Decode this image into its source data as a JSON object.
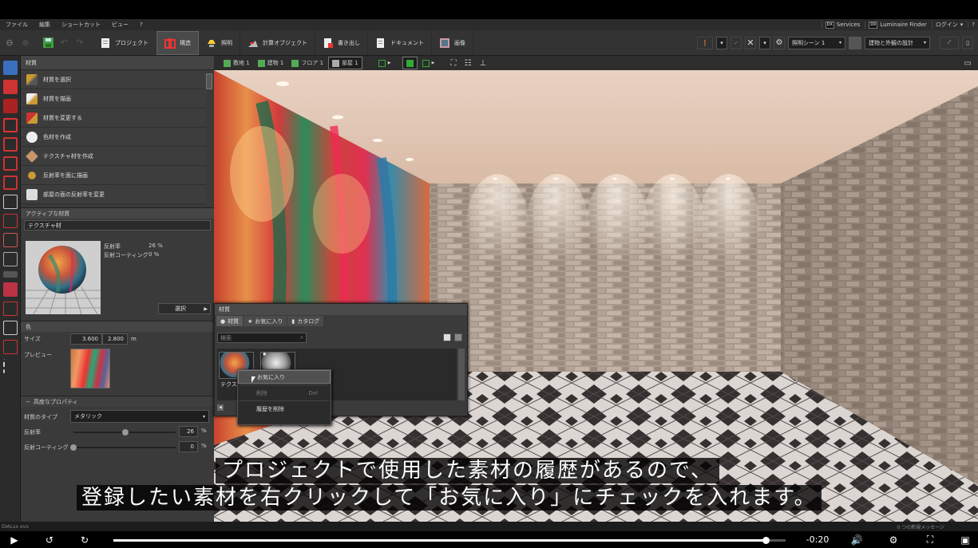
{
  "menu": [
    "ファイル",
    "編集",
    "ショートカット",
    "ビュー",
    "?"
  ],
  "menu_right": {
    "services": "Services",
    "luminaire": "Luminaire Finder",
    "login": "ログイン"
  },
  "toolbar": {
    "tabs": [
      "プロジェクト",
      "構造",
      "照明",
      "計算オブジェクト",
      "書き出し",
      "ドキュメント",
      "画像"
    ],
    "active_tab": "構造",
    "scene_dropdown": "照明シーン 1",
    "mode_dropdown": "建物と外観の設計"
  },
  "panel": {
    "title": "材質",
    "items": [
      "材質を選択",
      "材質を描画",
      "材質を変更する",
      "色材を作成",
      "テクスチャ材を作成",
      "反射率を面に描画",
      "部屋の面の反射率を変更"
    ],
    "active_material": {
      "header": "アクティブな材質",
      "name": "テクスチャ材",
      "reflectance_label": "反射率",
      "reflectance_value": "26 %",
      "coating_label": "反射コーティング",
      "coating_value": "0 %",
      "select_button": "選択"
    },
    "color": {
      "header": "色",
      "size_label": "サイズ",
      "size_w": "3.600",
      "size_h": "2.800",
      "size_unit": "m",
      "preview_label": "プレビュー"
    },
    "advanced": {
      "header": "高度なプロパティ",
      "type_label": "材質のタイプ",
      "type_value": "メタリック",
      "reflectance_label": "反射率",
      "reflectance_value": "26",
      "coating_label": "反射コーティング",
      "coating_value": "0",
      "percent": "%",
      "reflectance_slider": 0.26,
      "coating_slider": 0.0
    }
  },
  "viewtabs": [
    "敷地 1",
    "建物 1",
    "フロア 1",
    "部屋 1"
  ],
  "active_viewtab": "部屋 1",
  "dialog": {
    "title": "材質",
    "tabs": [
      "材質",
      "お気に入り",
      "カタログ"
    ],
    "search_placeholder": "検索",
    "thumb_label": "テクスチ"
  },
  "context_menu": {
    "items": [
      {
        "label": "お気に入り",
        "shortcut": "",
        "disabled": false,
        "highlight": true
      },
      {
        "label": "削除",
        "shortcut": "Del",
        "disabled": true,
        "highlight": false
      },
      {
        "label": "履歴を削除",
        "shortcut": "",
        "disabled": false,
        "highlight": false
      }
    ]
  },
  "subtitles": {
    "line1": "プロジェクトで使用した素材の履歴があるので、",
    "line2": "登録したい素材を右クリックして「お気に入り」にチェックを入れます。"
  },
  "status": {
    "left": "DIALux evo",
    "right": "0 つの新規メッセージ"
  },
  "player": {
    "time": "-0:20",
    "progress": 0.97
  },
  "colors": {
    "accent_green": "#3fa03f",
    "panel": "#3a3a3a",
    "subtitle_bg": "#000000"
  }
}
